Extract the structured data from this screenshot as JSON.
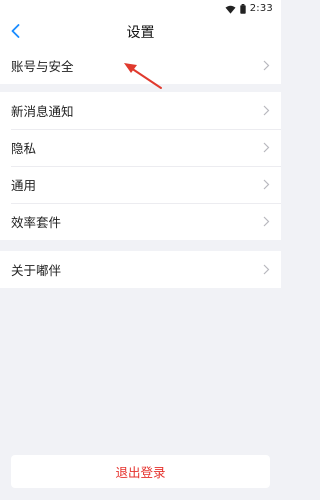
{
  "status_bar": {
    "time": "2:33"
  },
  "nav": {
    "title": "设置"
  },
  "groups": [
    {
      "items": [
        {
          "label": "账号与安全"
        }
      ]
    },
    {
      "items": [
        {
          "label": "新消息通知"
        },
        {
          "label": "隐私"
        },
        {
          "label": "通用"
        },
        {
          "label": "效率套件"
        }
      ]
    },
    {
      "items": [
        {
          "label": "关于嘟伴"
        }
      ]
    }
  ],
  "logout": {
    "label": "退出登录"
  },
  "colors": {
    "accent": "#1a8cff",
    "danger": "#e5322d",
    "background": "#f1f2f6"
  }
}
